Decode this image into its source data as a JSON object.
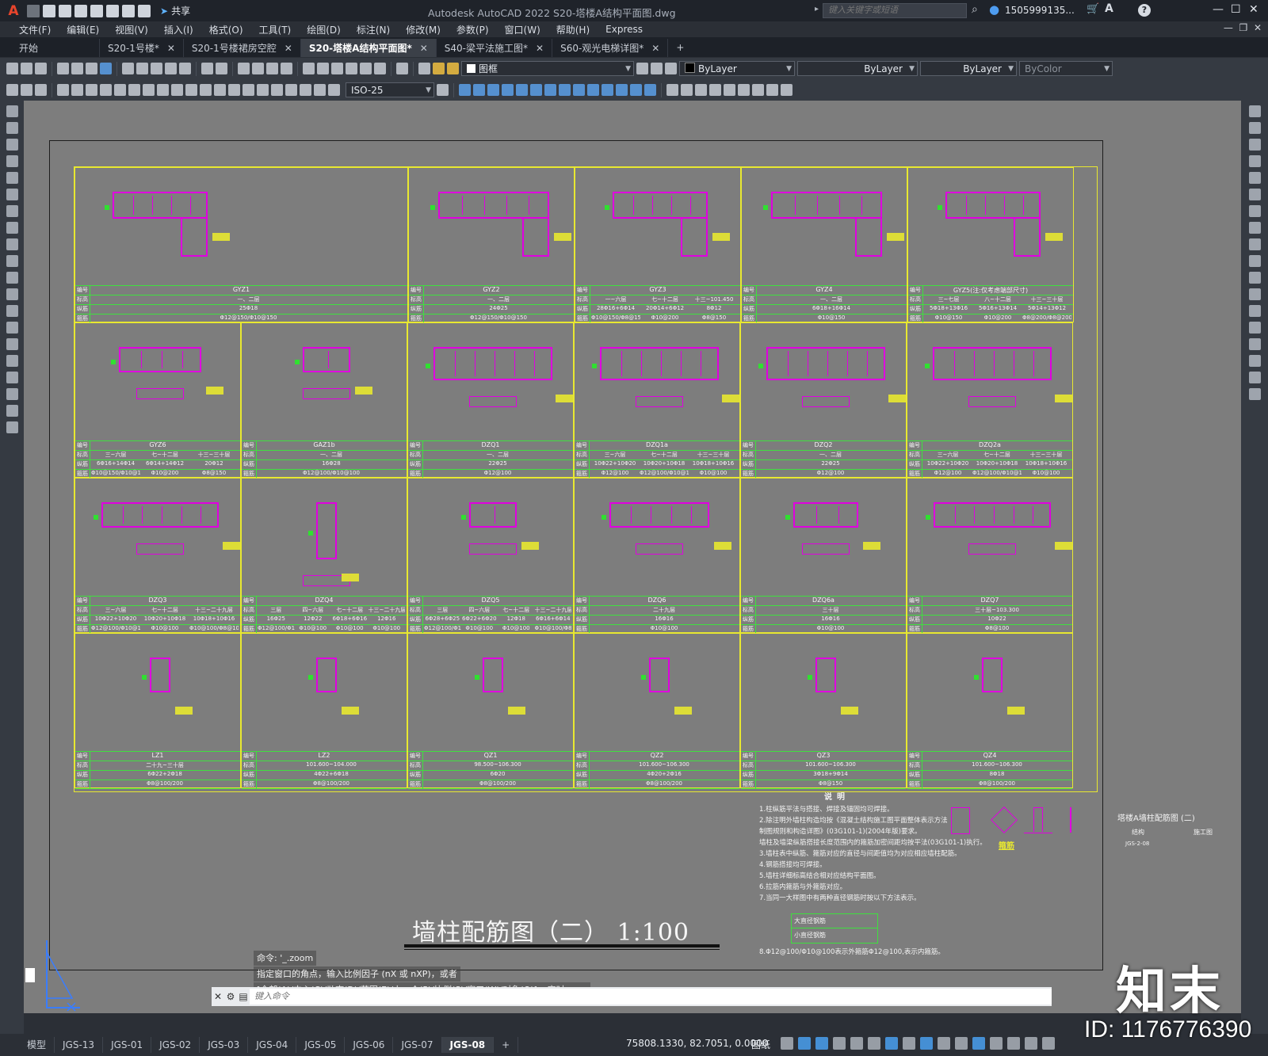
{
  "app": {
    "title": "Autodesk AutoCAD 2022    S20-塔楼A结构平面图.dwg",
    "search_placeholder": "键入关键字或短语",
    "user": "1505999135...",
    "share_label": "共享"
  },
  "menu": [
    "文件(F)",
    "编辑(E)",
    "视图(V)",
    "插入(I)",
    "格式(O)",
    "工具(T)",
    "绘图(D)",
    "标注(N)",
    "修改(M)",
    "参数(P)",
    "窗口(W)",
    "帮助(H)",
    "Express"
  ],
  "tabs": [
    {
      "label": "开始",
      "closable": false,
      "active": false
    },
    {
      "label": "S20-1号楼*",
      "closable": true,
      "active": false
    },
    {
      "label": "S20-1号楼裙房空腔",
      "closable": true,
      "active": false
    },
    {
      "label": "S20-塔楼A结构平面图*",
      "closable": true,
      "active": true
    },
    {
      "label": "S40-梁平法施工图*",
      "closable": true,
      "active": false
    },
    {
      "label": "S60-观光电梯详图*",
      "closable": true,
      "active": false
    }
  ],
  "properties": {
    "layer": "图框",
    "color": "ByLayer",
    "linetype": "ByLayer",
    "lineweight": "ByLayer",
    "plotstyle": "ByColor",
    "dimstyle": "ISO-25"
  },
  "schedule": {
    "row_labels": [
      "编号",
      "标高",
      "纵筋",
      "箍筋"
    ],
    "rows": [
      [
        {
          "name": "GYZ1",
          "vals": [
            [
              "一、二层"
            ],
            [
              "25Φ18"
            ],
            [
              "Φ12@150/Φ10@150"
            ]
          ]
        },
        {
          "name": "GYZ2",
          "vals": [
            [
              "一、二层"
            ],
            [
              "24Φ25"
            ],
            [
              "Φ12@150/Φ10@150"
            ]
          ]
        },
        {
          "name": "GYZ3",
          "vals": [
            [
              "一~六层",
              "七~十二层",
              "十三~101.450"
            ],
            [
              "28Φ16+6Φ14",
              "20Φ14+6Φ12",
              "8Φ12"
            ],
            [
              "Φ10@150/Φ8@150",
              "Φ10@200",
              "Φ8@150"
            ]
          ]
        },
        {
          "name": "GYZ4",
          "vals": [
            [
              "一、二层"
            ],
            [
              "6Φ18+16Φ14"
            ],
            [
              "Φ10@150"
            ]
          ]
        },
        {
          "name": "GYZ5(注:仅考虑端部尺寸)",
          "vals": [
            [
              "三~七层",
              "八~十二层",
              "十三~三十层"
            ],
            [
              "5Φ18+13Φ16",
              "5Φ16+13Φ14",
              "5Φ14+13Φ12"
            ],
            [
              "Φ10@150",
              "Φ10@200",
              "Φ8@200/Φ8@200"
            ]
          ]
        }
      ],
      [
        {
          "name": "GYZ6",
          "vals": [
            [
              "三~六层",
              "七~十二层",
              "十三~三十层"
            ],
            [
              "6Φ16+14Φ14",
              "6Φ14+14Φ12",
              "20Φ12"
            ],
            [
              "Φ10@150/Φ10@150",
              "Φ10@200",
              "Φ8@150"
            ]
          ]
        },
        {
          "name": "GAZ1b",
          "vals": [
            [
              "一、二层"
            ],
            [
              "16Φ28"
            ],
            [
              "Φ12@100/Φ10@100"
            ]
          ]
        },
        {
          "name": "DZQ1",
          "vals": [
            [
              "一、二层"
            ],
            [
              "22Φ25"
            ],
            [
              "Φ12@100"
            ]
          ]
        },
        {
          "name": "DZQ1a",
          "vals": [
            [
              "三~六层",
              "七~十二层",
              "十三~三十层"
            ],
            [
              "10Φ22+10Φ20",
              "10Φ20+10Φ18",
              "10Φ18+10Φ16"
            ],
            [
              "Φ12@100",
              "Φ12@100/Φ10@100",
              "Φ10@100"
            ]
          ]
        },
        {
          "name": "DZQ2",
          "vals": [
            [
              "一、二层"
            ],
            [
              "22Φ25"
            ],
            [
              "Φ12@100"
            ]
          ]
        },
        {
          "name": "DZQ2a",
          "vals": [
            [
              "三~六层",
              "七~十二层",
              "十三~三十层"
            ],
            [
              "10Φ22+10Φ20",
              "10Φ20+10Φ18",
              "10Φ18+10Φ16"
            ],
            [
              "Φ12@100",
              "Φ12@100/Φ10@100",
              "Φ10@100"
            ]
          ]
        }
      ],
      [
        {
          "name": "DZQ3",
          "vals": [
            [
              "三~六层",
              "七~十二层",
              "十三~二十九层"
            ],
            [
              "10Φ22+10Φ20",
              "10Φ20+10Φ18",
              "10Φ18+10Φ16"
            ],
            [
              "Φ12@100/Φ10@100",
              "Φ10@100",
              "Φ10@100/Φ8@100"
            ]
          ]
        },
        {
          "name": "DZQ4",
          "vals": [
            [
              "三层",
              "四~六层",
              "七~十二层",
              "十三~二十九层"
            ],
            [
              "16Φ25",
              "12Φ22",
              "6Φ18+6Φ16",
              "12Φ16"
            ],
            [
              "Φ12@100/Φ10@100",
              "Φ10@100",
              "Φ10@100",
              "Φ10@100"
            ]
          ]
        },
        {
          "name": "DZQ5",
          "vals": [
            [
              "三层",
              "四~六层",
              "七~十二层",
              "十三~二十九层"
            ],
            [
              "6Φ28+6Φ25",
              "6Φ22+6Φ20",
              "12Φ18",
              "6Φ16+6Φ14"
            ],
            [
              "Φ12@100/Φ10@100",
              "Φ10@100",
              "Φ10@100",
              "Φ10@100/Φ8@100"
            ]
          ]
        },
        {
          "name": "DZQ6",
          "vals": [
            [
              "二十九层"
            ],
            [
              "16Φ16"
            ],
            [
              "Φ10@100"
            ]
          ]
        },
        {
          "name": "DZQ6a",
          "vals": [
            [
              "三十层"
            ],
            [
              "16Φ16"
            ],
            [
              "Φ10@100"
            ]
          ]
        },
        {
          "name": "DZQ7",
          "vals": [
            [
              "三十层~103.300"
            ],
            [
              "10Φ22"
            ],
            [
              "Φ8@100"
            ]
          ]
        }
      ],
      [
        {
          "name": "LZ1",
          "vals": [
            [
              "二十九~三十层"
            ],
            [
              "6Φ22+2Φ18"
            ],
            [
              "Φ8@100/200"
            ]
          ]
        },
        {
          "name": "LZ2",
          "vals": [
            [
              "101.600~104.000"
            ],
            [
              "4Φ22+6Φ18"
            ],
            [
              "Φ8@100/200"
            ]
          ]
        },
        {
          "name": "QZ1",
          "vals": [
            [
              "98.500~106.300"
            ],
            [
              "6Φ20"
            ],
            [
              "Φ8@100/200"
            ]
          ]
        },
        {
          "name": "QZ2",
          "vals": [
            [
              "101.600~106.300"
            ],
            [
              "4Φ20+2Φ16"
            ],
            [
              "Φ8@100/200"
            ]
          ]
        },
        {
          "name": "QZ3",
          "vals": [
            [
              "101.600~106.300"
            ],
            [
              "3Φ18+9Φ14"
            ],
            [
              "Φ8@150"
            ]
          ]
        },
        {
          "name": "QZ4",
          "vals": [
            [
              "101.600~106.300"
            ],
            [
              "8Φ18"
            ],
            [
              "Φ8@100/200"
            ]
          ]
        }
      ]
    ]
  },
  "notes": {
    "title": "说明",
    "items": [
      "1.柱纵筋平法与搭接、焊接及锚固均可焊接。",
      "2.除注明外墙柱构造均按《混凝土结构施工图平面整体表示方法",
      "  制图规则和构造详图》(03G101-1)(2004年版)要求。",
      "  墙柱及墙梁纵筋搭接长度范围内的箍筋加密间距均按平法(03G101-1)执行。",
      "3.墙柱表中纵筋、箍筋对应的直径与间距值均为对应相应墙柱配筋。",
      "4.钢筋搭接均可焊接。",
      "5.墙柱详细标高结合相对应结构平面图。",
      "6.拉筋内箍筋与外箍筋对应。",
      "7.当同一大样图中有两种直径钢筋时按以下方法表示。"
    ],
    "legend": [
      "大直径钢筋",
      "小直径钢筋"
    ],
    "item8": "8.Φ12@100/Φ10@100表示外箍筋Φ12@100,表示内箍筋。",
    "section_label": "箍筋"
  },
  "drawing_title": "墙柱配筋图（二）  1:100",
  "titleblock": {
    "name": "塔楼A墙柱配筋图 (二)",
    "sub1": "结构",
    "sub2": "施工图",
    "code": "JGS-2-08"
  },
  "command": {
    "history": [
      "命令: '_.zoom",
      "指定窗口的角点，输入比例因子 (nX 或 nXP)，或者",
      "[全部(A)/中心(C)/动态(D)/范围(E)/上一个(P)/比例(S)/窗口(W)/对象(O)] <实时>: _e"
    ],
    "placeholder": "键入命令"
  },
  "layout_tabs": [
    {
      "label": "模型",
      "active": false
    },
    {
      "label": "JGS-13",
      "active": false
    },
    {
      "label": "JGS-01",
      "active": false
    },
    {
      "label": "JGS-02",
      "active": false
    },
    {
      "label": "JGS-03",
      "active": false
    },
    {
      "label": "JGS-04",
      "active": false
    },
    {
      "label": "JGS-05",
      "active": false
    },
    {
      "label": "JGS-06",
      "active": false
    },
    {
      "label": "JGS-07",
      "active": false
    },
    {
      "label": "JGS-08",
      "active": true
    }
  ],
  "status": {
    "coords": "75808.1330, 82.7051, 0.0000",
    "space": "图纸"
  },
  "watermark": {
    "logo": "知末",
    "id": "ID: 1176776390"
  },
  "colors": {
    "grid_yellow": "#e8e830",
    "grid_green": "#3fe03f",
    "rebar_magenta": "#e000e0",
    "canvas_gray": "#7d7d7d"
  }
}
